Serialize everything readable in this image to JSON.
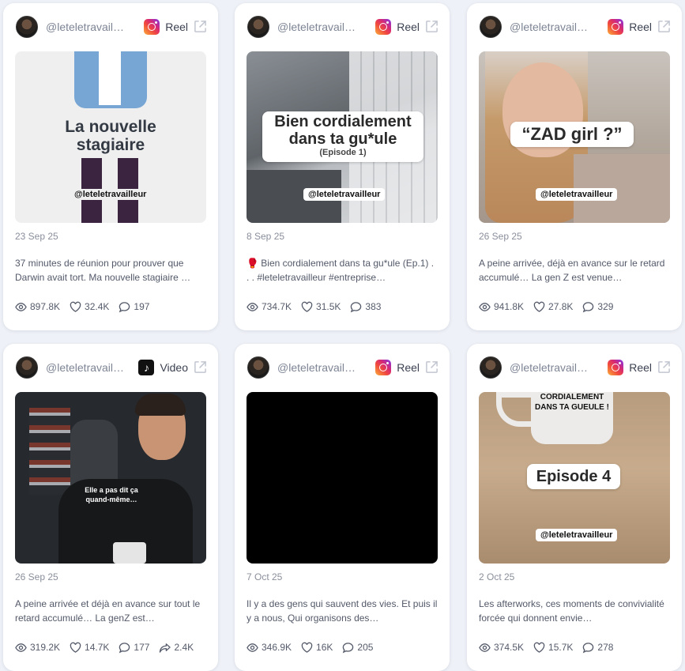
{
  "cards": [
    {
      "handle": "@leteletravailleur",
      "platform": "Reel",
      "platform_icon": "instagram-icon",
      "date": "23 Sep 25",
      "caption": "37 minutes de réunion pour prouver que Darwin avait tort. Ma nouvelle stagiaire …",
      "overlay": "La nouvelle stagiaire",
      "watermark": "@leteletravailleur",
      "views": "897.8K",
      "likes": "32.4K",
      "comments": "197"
    },
    {
      "handle": "@leteletravailleur",
      "platform": "Reel",
      "platform_icon": "instagram-icon",
      "date": "8 Sep 25",
      "caption": "🥊 Bien cordialement dans ta gu*ule (Ep.1) . . . #leteletravailleur #entreprise…",
      "overlay": "Bien cordialement dans ta gu*ule",
      "overlay_sub": "(Episode 1)",
      "watermark": "@leteletravailleur",
      "views": "734.7K",
      "likes": "31.5K",
      "comments": "383"
    },
    {
      "handle": "@leteletravailleur",
      "platform": "Reel",
      "platform_icon": "instagram-icon",
      "date": "26 Sep 25",
      "caption": "A peine arrivée, déjà en avance sur le retard accumulé… La gen Z est venue…",
      "overlay": "“ZAD girl ?”",
      "watermark": "@leteletravailleur",
      "views": "941.8K",
      "likes": "27.8K",
      "comments": "329"
    },
    {
      "handle": "@leteletravaill…",
      "platform": "Video",
      "platform_icon": "tiktok-icon",
      "date": "26 Sep 25",
      "caption": "A peine arrivée et déjà en avance sur tout le retard accumulé… La genZ est…",
      "overlay": "Elle a pas dit ça quand-même…",
      "views": "319.2K",
      "likes": "14.7K",
      "comments": "177",
      "shares": "2.4K"
    },
    {
      "handle": "@leteletravailleur",
      "platform": "Reel",
      "platform_icon": "instagram-icon",
      "date": "7 Oct 25",
      "caption": "Il y a des gens qui sauvent des vies. Et puis il y a nous, Qui organisons des…",
      "views": "346.9K",
      "likes": "16K",
      "comments": "205"
    },
    {
      "handle": "@leteletravailleur",
      "platform": "Reel",
      "platform_icon": "instagram-icon",
      "date": "2 Oct 25",
      "caption": "Les afterworks, ces moments de convivialité forcée qui donnent envie…",
      "overlay": "Episode 4",
      "mug_text": "CORDIALEMENT DANS TA GUEULE !",
      "watermark": "@leteletravailleur",
      "views": "374.5K",
      "likes": "15.7K",
      "comments": "278"
    }
  ]
}
